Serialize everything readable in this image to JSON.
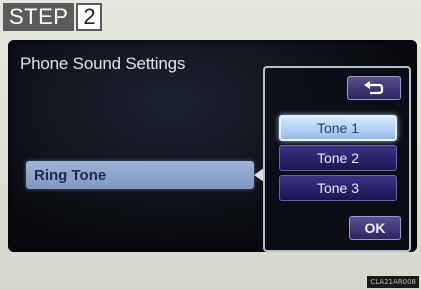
{
  "step": {
    "word": "STEP",
    "number": "2"
  },
  "screen": {
    "title": "Phone Sound Settings",
    "ring_row": {
      "label": "Ring Tone"
    },
    "popup": {
      "back_icon": "return-arrow-icon",
      "tones": [
        {
          "label": "Tone 1",
          "selected": true
        },
        {
          "label": "Tone 2",
          "selected": false
        },
        {
          "label": "Tone 3",
          "selected": false
        }
      ],
      "ok_label": "OK"
    }
  },
  "image_code": "CLA21AR008",
  "colors": {
    "selected_tone": "#a9c9ee",
    "tone_button": "#2d2468",
    "ring_row": "#8aa2cc"
  }
}
